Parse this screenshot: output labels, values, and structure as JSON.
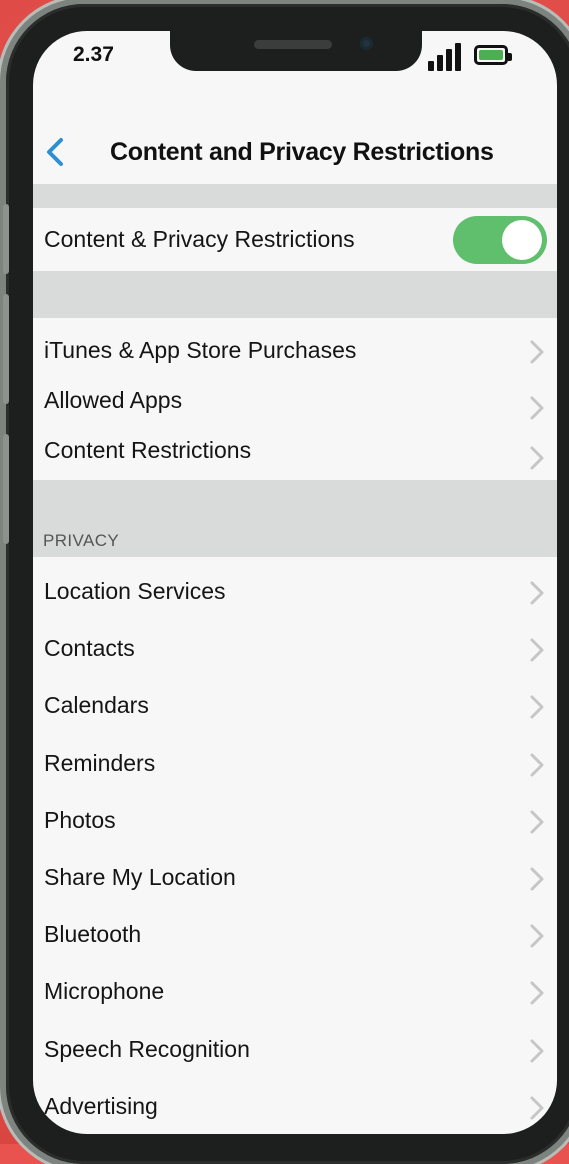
{
  "status_bar": {
    "time": "2.37"
  },
  "nav": {
    "title": "Content and Privacy Restrictions"
  },
  "master_toggle": {
    "label": "Content & Privacy Restrictions",
    "on": true
  },
  "store_section": {
    "items": [
      {
        "label": "iTunes & App Store Purchases"
      },
      {
        "label": "Allowed Apps"
      },
      {
        "label": "Content Restrictions"
      }
    ]
  },
  "privacy_section": {
    "header": "PRIVACY",
    "items": [
      {
        "label": "Location Services"
      },
      {
        "label": "Contacts"
      },
      {
        "label": "Calendars"
      },
      {
        "label": "Reminders"
      },
      {
        "label": "Photos"
      },
      {
        "label": "Share My Location"
      },
      {
        "label": "Bluetooth"
      },
      {
        "label": "Microphone"
      },
      {
        "label": "Speech Recognition"
      },
      {
        "label": "Advertising"
      }
    ]
  },
  "colors": {
    "accent": "#2f8fd0",
    "toggle_on": "#5fbf6c",
    "background": "#e8534f"
  }
}
